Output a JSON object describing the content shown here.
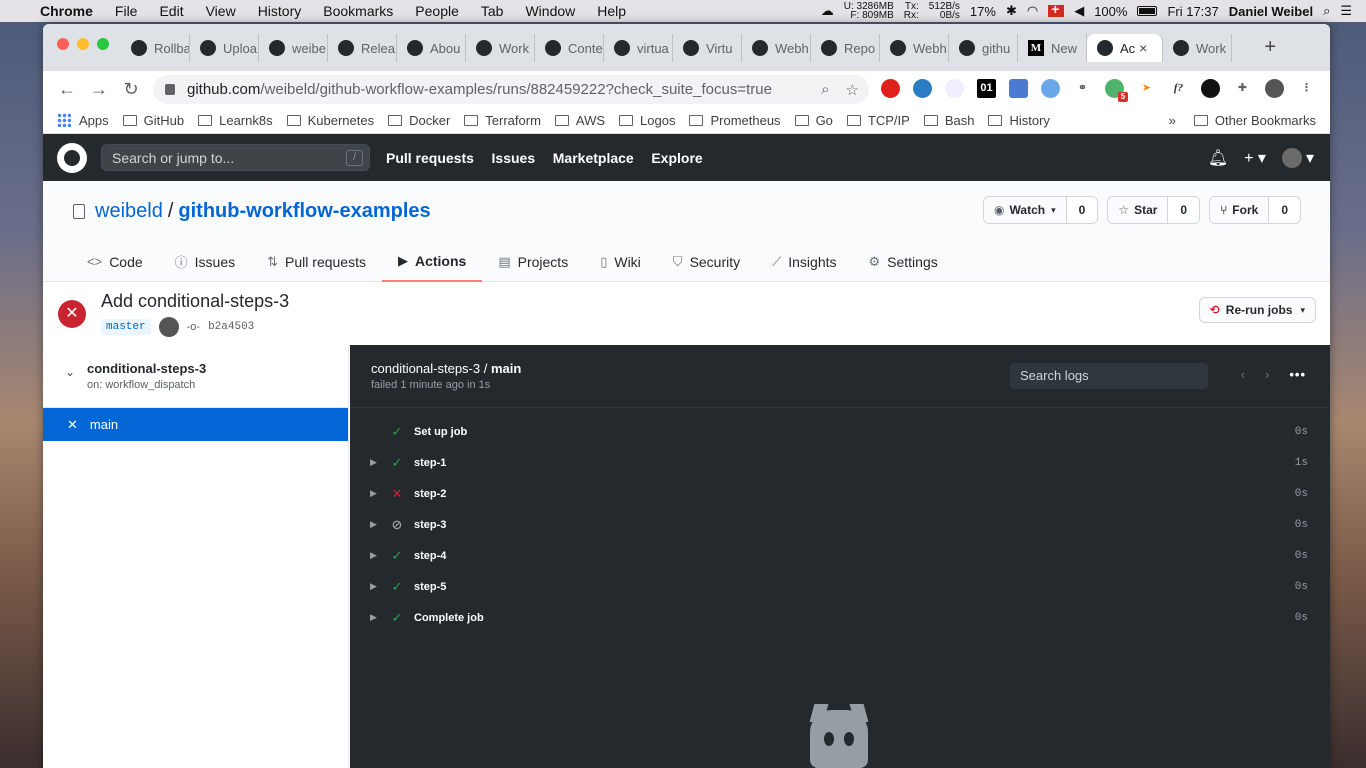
{
  "menubar": {
    "app": "Chrome",
    "items": [
      "File",
      "Edit",
      "View",
      "History",
      "Bookmarks",
      "People",
      "Tab",
      "Window",
      "Help"
    ],
    "net_up": "U: 3286MB",
    "net_down": "F:  809MB",
    "tx": "Tx:",
    "rx": "Rx:",
    "tx_rate": "512B/s",
    "rx_rate": "0B/s",
    "cpu": "17%",
    "battery": "100%",
    "clock": "Fri 17:37",
    "user": "Daniel Weibel"
  },
  "browser": {
    "tabs": [
      {
        "label": "Rollba"
      },
      {
        "label": "Uploa"
      },
      {
        "label": "weibe"
      },
      {
        "label": "Relea"
      },
      {
        "label": "Abou"
      },
      {
        "label": "Work"
      },
      {
        "label": "Conte"
      },
      {
        "label": "virtua"
      },
      {
        "label": "Virtu"
      },
      {
        "label": "Webh"
      },
      {
        "label": "Repo"
      },
      {
        "label": "Webh"
      },
      {
        "label": "githu"
      },
      {
        "label": "New"
      },
      {
        "label": "Ac"
      },
      {
        "label": "Work"
      }
    ],
    "active_tab_index": 14,
    "url_host": "github.com",
    "url_path": "/weibeld/github-workflow-examples/runs/882459222?check_suite_focus=true",
    "bookmarks": [
      "Apps",
      "GitHub",
      "Learnk8s",
      "Kubernetes",
      "Docker",
      "Terraform",
      "AWS",
      "Logos",
      "Prometheus",
      "Go",
      "TCP/IP",
      "Bash",
      "History"
    ],
    "other_bookmarks": "Other Bookmarks",
    "ext_badge": "5",
    "ext_01": "01",
    "ext_f": "f?"
  },
  "gh": {
    "search_placeholder": "Search or jump to...",
    "search_key": "/",
    "nav": [
      "Pull requests",
      "Issues",
      "Marketplace",
      "Explore"
    ],
    "owner": "weibeld",
    "repo": "github-workflow-examples",
    "watch": "Watch",
    "watch_count": "0",
    "star": "Star",
    "star_count": "0",
    "fork": "Fork",
    "fork_count": "0",
    "tabs": [
      "Code",
      "Issues",
      "Pull requests",
      "Actions",
      "Projects",
      "Wiki",
      "Security",
      "Insights",
      "Settings"
    ],
    "selected_tab": "Actions"
  },
  "run": {
    "title": "Add conditional-steps-3",
    "branch": "master",
    "sha": "b2a4503",
    "rerun": "Re-run jobs",
    "workflow": "conditional-steps-3",
    "trigger": "on: workflow_dispatch",
    "job": "main",
    "log_title_prefix": "conditional-steps-3 / ",
    "log_title_job": "main",
    "log_status": "failed 1 minute ago in 1s",
    "search_logs": "Search logs",
    "steps": [
      {
        "name": "Set up job",
        "status": "success",
        "duration": "0s",
        "expandable": false
      },
      {
        "name": "step-1",
        "status": "success",
        "duration": "1s",
        "expandable": true
      },
      {
        "name": "step-2",
        "status": "failure",
        "duration": "0s",
        "expandable": true
      },
      {
        "name": "step-3",
        "status": "skipped",
        "duration": "0s",
        "expandable": true
      },
      {
        "name": "step-4",
        "status": "success",
        "duration": "0s",
        "expandable": true
      },
      {
        "name": "step-5",
        "status": "success",
        "duration": "0s",
        "expandable": true
      },
      {
        "name": "Complete job",
        "status": "success",
        "duration": "0s",
        "expandable": true
      }
    ]
  },
  "colors": {
    "accent": "#0366d6",
    "failure": "#cb2431",
    "success": "#28a745",
    "header": "#24292e",
    "log_bg": "#24292e"
  }
}
